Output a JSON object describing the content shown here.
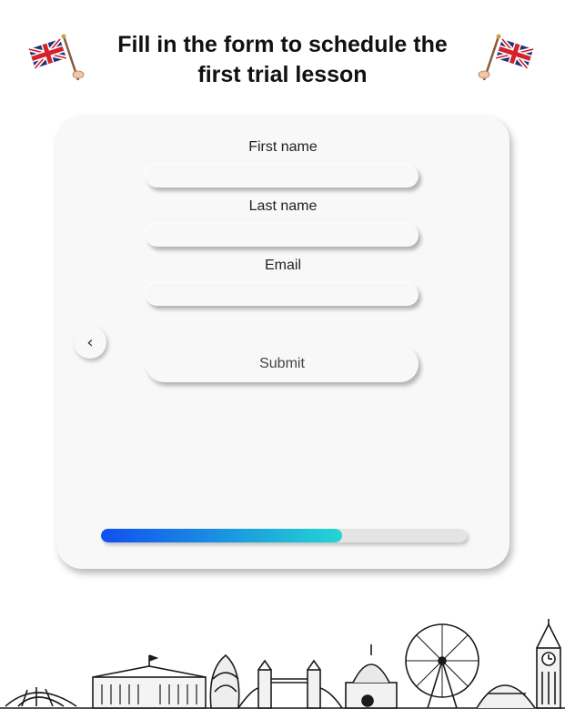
{
  "header": {
    "title": "Fill in the form to schedule the first trial lesson",
    "flag_icon": "uk-flag-icon"
  },
  "form": {
    "fields": [
      {
        "label": "First name",
        "value": "",
        "placeholder": ""
      },
      {
        "label": "Last name",
        "value": "",
        "placeholder": ""
      },
      {
        "label": "Email",
        "value": "",
        "placeholder": ""
      }
    ],
    "back_label": "‹",
    "submit_label": "Submit",
    "progress_fraction": 0.66
  },
  "colors": {
    "card_bg": "#f8f8f8",
    "progress_start": "#1150f0",
    "progress_end": "#24d6d2",
    "progress_track": "#e4e4e4"
  },
  "footer": {
    "illustration": "london-skyline-illustration"
  }
}
